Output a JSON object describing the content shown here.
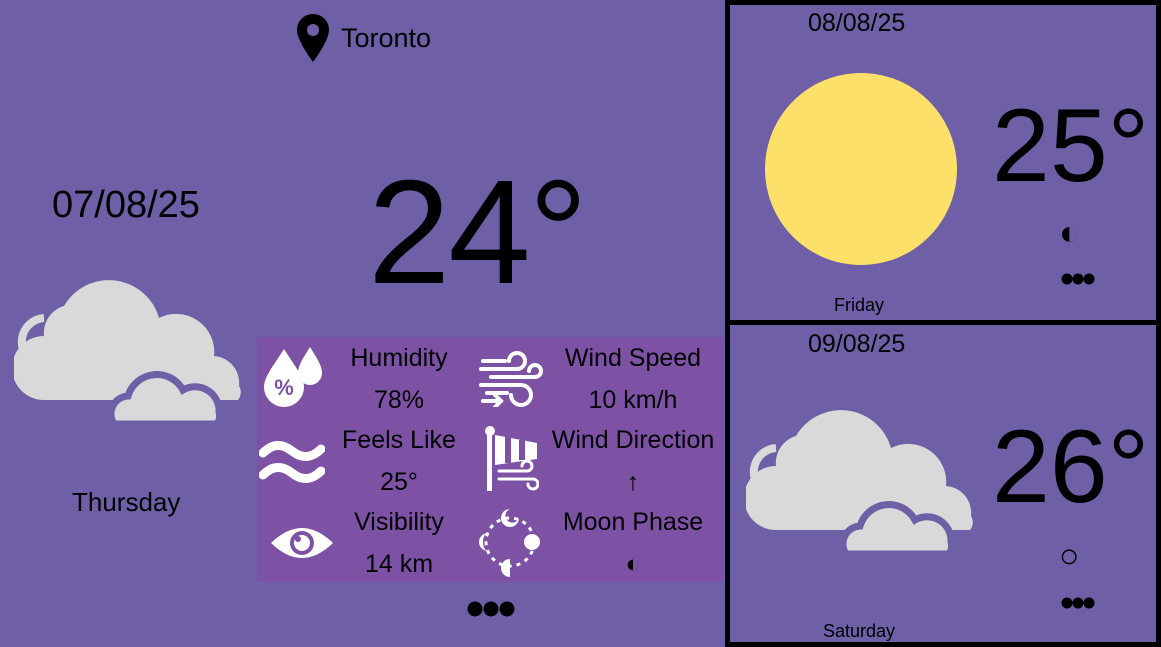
{
  "location": {
    "name": "Toronto",
    "icon": "map-pin-icon"
  },
  "today": {
    "date": "07/08/25",
    "temperature": "24°",
    "day": "Thursday",
    "condition_icon": "cloudy-icon",
    "details": {
      "humidity": {
        "label": "Humidity",
        "value": "78%",
        "icon": "humidity-icon"
      },
      "feels_like": {
        "label": "Feels Like",
        "value": "25°",
        "icon": "feels-like-icon"
      },
      "visibility": {
        "label": "Visibility",
        "value": "14 km",
        "icon": "eye-icon"
      },
      "wind_speed": {
        "label": "Wind Speed",
        "value": "10 km/h",
        "icon": "wind-icon"
      },
      "wind_direction": {
        "label": "Wind Direction",
        "value": "↑",
        "icon": "windsock-icon"
      },
      "moon_phase": {
        "label": "Moon Phase",
        "value": "◐",
        "icon": "moon-phases-icon"
      }
    }
  },
  "forecast": [
    {
      "date": "08/08/25",
      "temperature": "25°",
      "day": "Friday",
      "condition_icon": "sun-icon",
      "moon": "◐"
    },
    {
      "date": "09/08/25",
      "temperature": "26°",
      "day": "Saturday",
      "condition_icon": "cloudy-icon",
      "moon": "○"
    }
  ],
  "colors": {
    "background": "#6e5fa6",
    "details_panel": "#7d52a5",
    "sun": "#fde06a",
    "cloud": "#d9d9d9"
  }
}
